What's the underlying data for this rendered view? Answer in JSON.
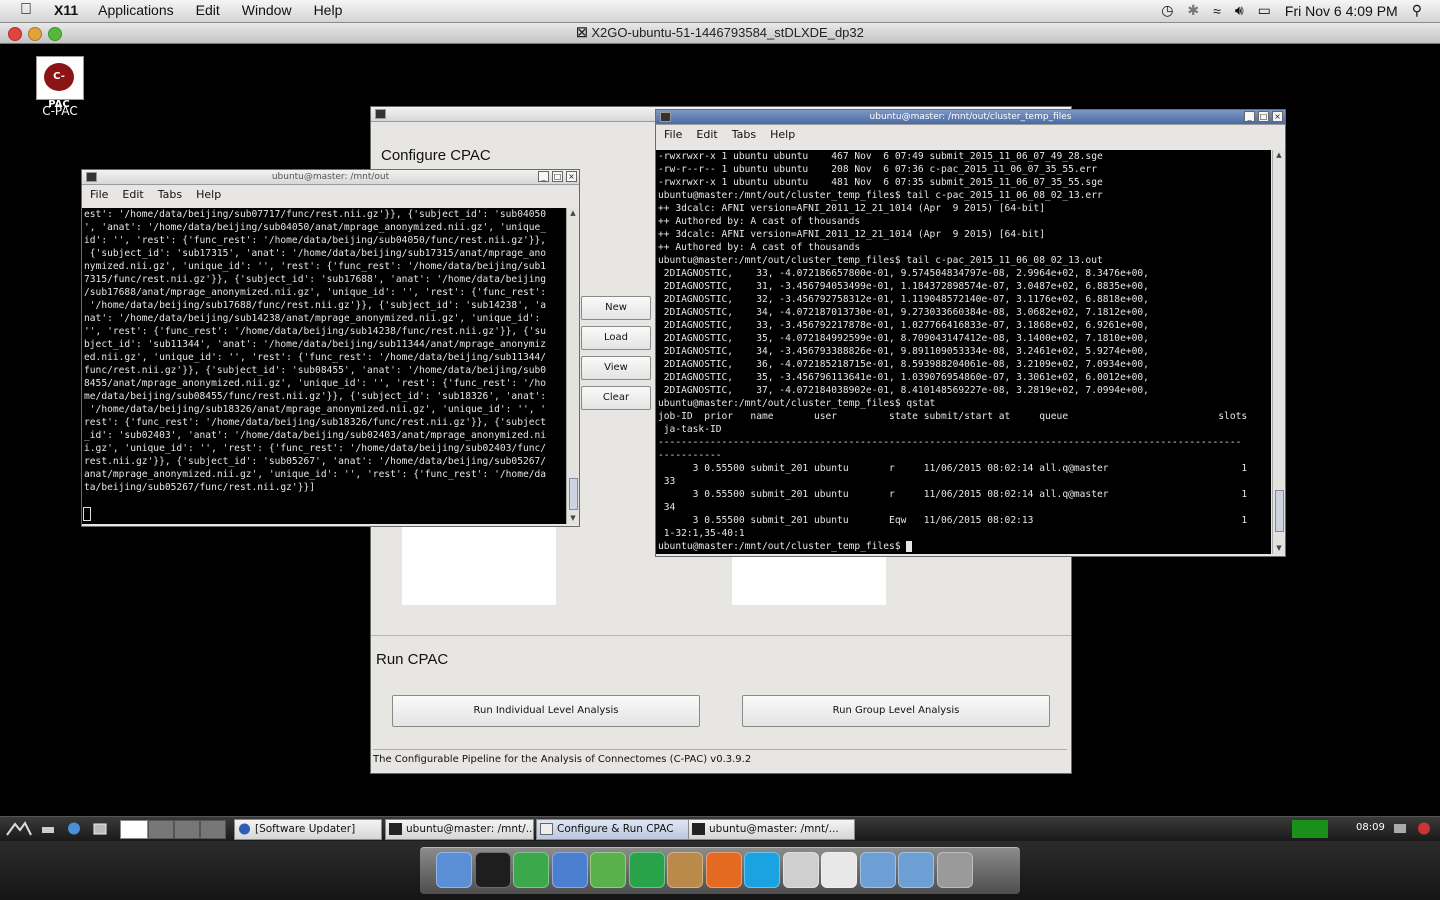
{
  "macbar": {
    "app_name": "X11",
    "menus": [
      "Applications",
      "Edit",
      "Window",
      "Help"
    ],
    "datetime": "Fri Nov 6  4:09 PM"
  },
  "x2go_window": {
    "title": "X2GO-ubuntu-51-1446793584_stDLXDE_dp32"
  },
  "desktop_icon": {
    "label": "C-PAC"
  },
  "term_left": {
    "title": "ubuntu@master: /mnt/out",
    "menus": [
      "File",
      "Edit",
      "Tabs",
      "Help"
    ],
    "lines": [
      "est': '/home/data/beijing/sub07717/func/rest.nii.gz'}}, {'subject_id': 'sub04050",
      "', 'anat': '/home/data/beijing/sub04050/anat/mprage_anonymized.nii.gz', 'unique_",
      "id': '', 'rest': {'func_rest': '/home/data/beijing/sub04050/func/rest.nii.gz'}},",
      " {'subject_id': 'sub17315', 'anat': '/home/data/beijing/sub17315/anat/mprage_ano",
      "nymized.nii.gz', 'unique_id': '', 'rest': {'func_rest': '/home/data/beijing/sub1",
      "7315/func/rest.nii.gz'}}, {'subject_id': 'sub17688', 'anat': '/home/data/beijing",
      "/sub17688/anat/mprage_anonymized.nii.gz', 'unique_id': '', 'rest': {'func_rest':",
      " '/home/data/beijing/sub17688/func/rest.nii.gz'}}, {'subject_id': 'sub14238', 'a",
      "nat': '/home/data/beijing/sub14238/anat/mprage_anonymized.nii.gz', 'unique_id':",
      "'', 'rest': {'func_rest': '/home/data/beijing/sub14238/func/rest.nii.gz'}}, {'su",
      "bject_id': 'sub11344', 'anat': '/home/data/beijing/sub11344/anat/mprage_anonymiz",
      "ed.nii.gz', 'unique_id': '', 'rest': {'func_rest': '/home/data/beijing/sub11344/",
      "func/rest.nii.gz'}}, {'subject_id': 'sub08455', 'anat': '/home/data/beijing/sub0",
      "8455/anat/mprage_anonymized.nii.gz', 'unique_id': '', 'rest': {'func_rest': '/ho",
      "me/data/beijing/sub08455/func/rest.nii.gz'}}, {'subject_id': 'sub18326', 'anat':",
      " '/home/data/beijing/sub18326/anat/mprage_anonymized.nii.gz', 'unique_id': '', '",
      "rest': {'func_rest': '/home/data/beijing/sub18326/func/rest.nii.gz'}}, {'subject",
      "_id': 'sub02403', 'anat': '/home/data/beijing/sub02403/anat/mprage_anonymized.ni",
      "i.gz', 'unique_id': '', 'rest': {'func_rest': '/home/data/beijing/sub02403/func/",
      "rest.nii.gz'}}, {'subject_id': 'sub05267', 'anat': '/home/data/beijing/sub05267/",
      "anat/mprage_anonymized.nii.gz', 'unique_id': '', 'rest': {'func_rest': '/home/da",
      "ta/beijing/sub05267/func/rest.nii.gz'}}]"
    ]
  },
  "cpac": {
    "configure_heading": "Configure CPAC",
    "buttons": {
      "new": "New",
      "load": "Load",
      "view": "View",
      "clear": "Clear"
    },
    "run_heading": "Run CPAC",
    "run_individual": "Run Individual Level Analysis",
    "run_group": "Run Group Level Analysis",
    "status": "The Configurable Pipeline for the Analysis of Connectomes (C-PAC) v0.3.9.2"
  },
  "term_right": {
    "title": "ubuntu@master: /mnt/out/cluster_temp_files",
    "menus": [
      "File",
      "Edit",
      "Tabs",
      "Help"
    ],
    "lines": [
      "-rwxrwxr-x 1 ubuntu ubuntu    467 Nov  6 07:49 submit_2015_11_06_07_49_28.sge",
      "-rw-r--r-- 1 ubuntu ubuntu    208 Nov  6 07:36 c-pac_2015_11_06_07_35_55.err",
      "-rwxrwxr-x 1 ubuntu ubuntu    481 Nov  6 07:35 submit_2015_11_06_07_35_55.sge",
      "ubuntu@master:/mnt/out/cluster_temp_files$ tail c-pac_2015_11_06_08_02_13.err",
      "++ 3dcalc: AFNI version=AFNI_2011_12_21_1014 (Apr  9 2015) [64-bit]",
      "++ Authored by: A cast of thousands",
      "++ 3dcalc: AFNI version=AFNI_2011_12_21_1014 (Apr  9 2015) [64-bit]",
      "++ Authored by: A cast of thousands",
      "ubuntu@master:/mnt/out/cluster_temp_files$ tail c-pac_2015_11_06_08_02_13.out",
      " 2DIAGNOSTIC,    33, -4.072186657800e-01, 9.574504834797e-08, 2.9964e+02, 8.3476e+00,",
      " 2DIAGNOSTIC,    31, -3.456794053499e-01, 1.184372898574e-07, 3.0487e+02, 6.8835e+00,",
      " 2DIAGNOSTIC,    32, -3.456792758312e-01, 1.119048572140e-07, 3.1176e+02, 6.8818e+00,",
      " 2DIAGNOSTIC,    34, -4.072187013730e-01, 9.273033660384e-08, 3.0682e+02, 7.1812e+00,",
      " 2DIAGNOSTIC,    33, -3.456792217878e-01, 1.027766416833e-07, 3.1868e+02, 6.9261e+00,",
      " 2DIAGNOSTIC,    35, -4.072184992599e-01, 8.709043147412e-08, 3.1400e+02, 7.1810e+00,",
      " 2DIAGNOSTIC,    34, -3.456793388826e-01, 9.891109053334e-08, 3.2461e+02, 5.9274e+00,",
      " 2DIAGNOSTIC,    36, -4.072185218715e-01, 8.593988204061e-08, 3.2109e+02, 7.0934e+00,",
      " 2DIAGNOSTIC,    35, -3.456796113641e-01, 1.039076954860e-07, 3.3061e+02, 6.0012e+00,",
      " 2DIAGNOSTIC,    37, -4.072184038902e-01, 8.410148569227e-08, 3.2819e+02, 7.0994e+00,",
      "ubuntu@master:/mnt/out/cluster_temp_files$ qstat",
      "job-ID  prior   name       user         state submit/start at     queue                          slots",
      " ja-task-ID",
      "-----------------------------------------------------------------------------------------------------",
      "-----------",
      "      3 0.55500 submit_201 ubuntu       r     11/06/2015 08:02:14 all.q@master                       1",
      " 33",
      "      3 0.55500 submit_201 ubuntu       r     11/06/2015 08:02:14 all.q@master                       1",
      " 34",
      "      3 0.55500 submit_201 ubuntu       Eqw   11/06/2015 08:02:13                                    1",
      " 1-32:1,35-40:1",
      "ubuntu@master:/mnt/out/cluster_temp_files$ "
    ]
  },
  "taskbar": {
    "tasks": [
      "[Software Updater]",
      "ubuntu@master: /mnt/...",
      "Configure & Run CPAC",
      "ubuntu@master: /mnt/..."
    ],
    "clock": "08:09"
  },
  "dock": {
    "apps": [
      "finder-icon",
      "terminal-icon",
      "text-editor-icon",
      "mail-icon",
      "user-icon",
      "checkmark-icon",
      "photos-icon",
      "firefox-icon",
      "skype-icon",
      "x11-icon",
      "xquartz-icon",
      "applications-folder-icon",
      "downloads-folder-icon",
      "trash-icon"
    ]
  }
}
